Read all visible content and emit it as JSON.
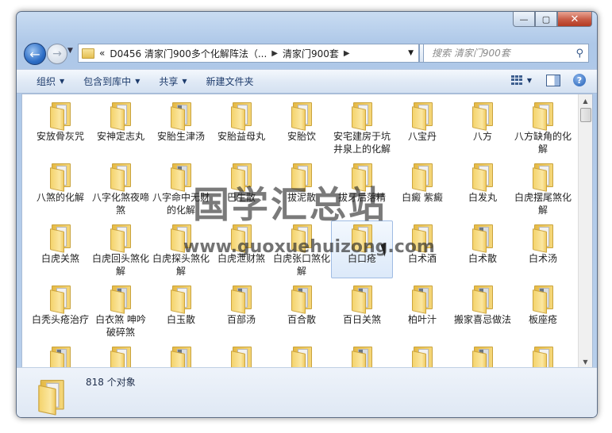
{
  "window": {
    "caption_buttons": {
      "minimize": "—",
      "maximize": "▢",
      "close": "✕"
    }
  },
  "address": {
    "overflow": "«",
    "crumbs": [
      "D0456 清家门900多个化解阵法（...",
      "清家门900套"
    ],
    "search_placeholder": "搜索 清家门900套"
  },
  "toolbar": {
    "organize": "组织",
    "include_in_library": "包含到库中",
    "share": "共享",
    "new_folder": "新建文件夹"
  },
  "items": [
    {
      "label": "安放骨灰咒",
      "paper": "light"
    },
    {
      "label": "安神定志丸",
      "paper": "light"
    },
    {
      "label": "安胎生津汤",
      "paper": "dark"
    },
    {
      "label": "安胎益母丸",
      "paper": "light"
    },
    {
      "label": "安胎饮",
      "paper": "light"
    },
    {
      "label": "安宅建房于坑井泉上的化解",
      "paper": "light"
    },
    {
      "label": "八宝丹",
      "paper": "light"
    },
    {
      "label": "八方",
      "paper": "light"
    },
    {
      "label": "八方缺角的化解",
      "paper": "light"
    },
    {
      "label": "八煞的化解",
      "paper": "light"
    },
    {
      "label": "八字化煞夜啼煞",
      "paper": "light"
    },
    {
      "label": "八字命中无财的化解",
      "paper": "dark"
    },
    {
      "label": "巴生散",
      "paper": "light"
    },
    {
      "label": "拔泥散",
      "paper": "light"
    },
    {
      "label": "拔牙后落精",
      "paper": "light"
    },
    {
      "label": "白癜 紫癜",
      "paper": "light"
    },
    {
      "label": "白发丸",
      "paper": "light"
    },
    {
      "label": "白虎摆尾煞化解",
      "paper": "light"
    },
    {
      "label": "白虎关煞",
      "paper": "light"
    },
    {
      "label": "白虎回头煞化解",
      "paper": "light"
    },
    {
      "label": "白虎探头煞化解",
      "paper": "light"
    },
    {
      "label": "白虎泄财煞",
      "paper": "light"
    },
    {
      "label": "白虎张口煞化解",
      "paper": "light"
    },
    {
      "label": "白口疮",
      "paper": "light",
      "selected": true
    },
    {
      "label": "白术酒",
      "paper": "light"
    },
    {
      "label": "白术散",
      "paper": "dark"
    },
    {
      "label": "白术汤",
      "paper": "light"
    },
    {
      "label": "白秃头疮治疗",
      "paper": "light"
    },
    {
      "label": "白衣煞 呻吟破碎煞",
      "paper": "dark"
    },
    {
      "label": "白玉散",
      "paper": "light"
    },
    {
      "label": "百部汤",
      "paper": "dark"
    },
    {
      "label": "百合散",
      "paper": "dark"
    },
    {
      "label": "百日关煞",
      "paper": "dark"
    },
    {
      "label": "柏叶汁",
      "paper": "dark"
    },
    {
      "label": "搬家喜忌做法",
      "paper": "dark"
    },
    {
      "label": "板座疮",
      "paper": "dark"
    },
    {
      "label": "",
      "paper": "dark"
    },
    {
      "label": "",
      "paper": "light"
    },
    {
      "label": "",
      "paper": "dark"
    },
    {
      "label": "",
      "paper": "light"
    },
    {
      "label": "",
      "paper": "light"
    },
    {
      "label": "",
      "paper": "dark"
    },
    {
      "label": "",
      "paper": "light"
    },
    {
      "label": "",
      "paper": "dark"
    },
    {
      "label": "",
      "paper": "light"
    }
  ],
  "watermark": {
    "title": "国学汇总站",
    "url": "www.guoxuehuizong.com"
  },
  "status": {
    "count": "818 个对象"
  }
}
